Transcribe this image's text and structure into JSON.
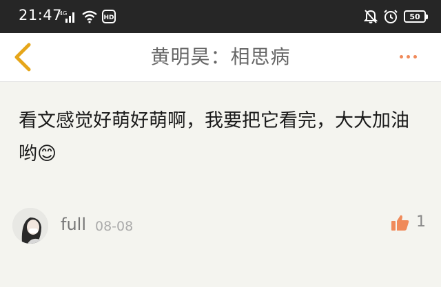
{
  "status_bar": {
    "time": "21:47",
    "network": "4G",
    "hd_badge": "HD",
    "battery": "50"
  },
  "header": {
    "title": "黄明昊：相思病"
  },
  "comment": {
    "text": "看文感觉好萌好萌啊，我要把它看完，大大加油哟",
    "emoji": "😊"
  },
  "author": {
    "username": "full",
    "date": "08-08"
  },
  "like": {
    "count": "1"
  },
  "colors": {
    "accent": "#f08a5a",
    "back_arrow": "#e6a61a",
    "status_bar_bg": "#262626"
  }
}
